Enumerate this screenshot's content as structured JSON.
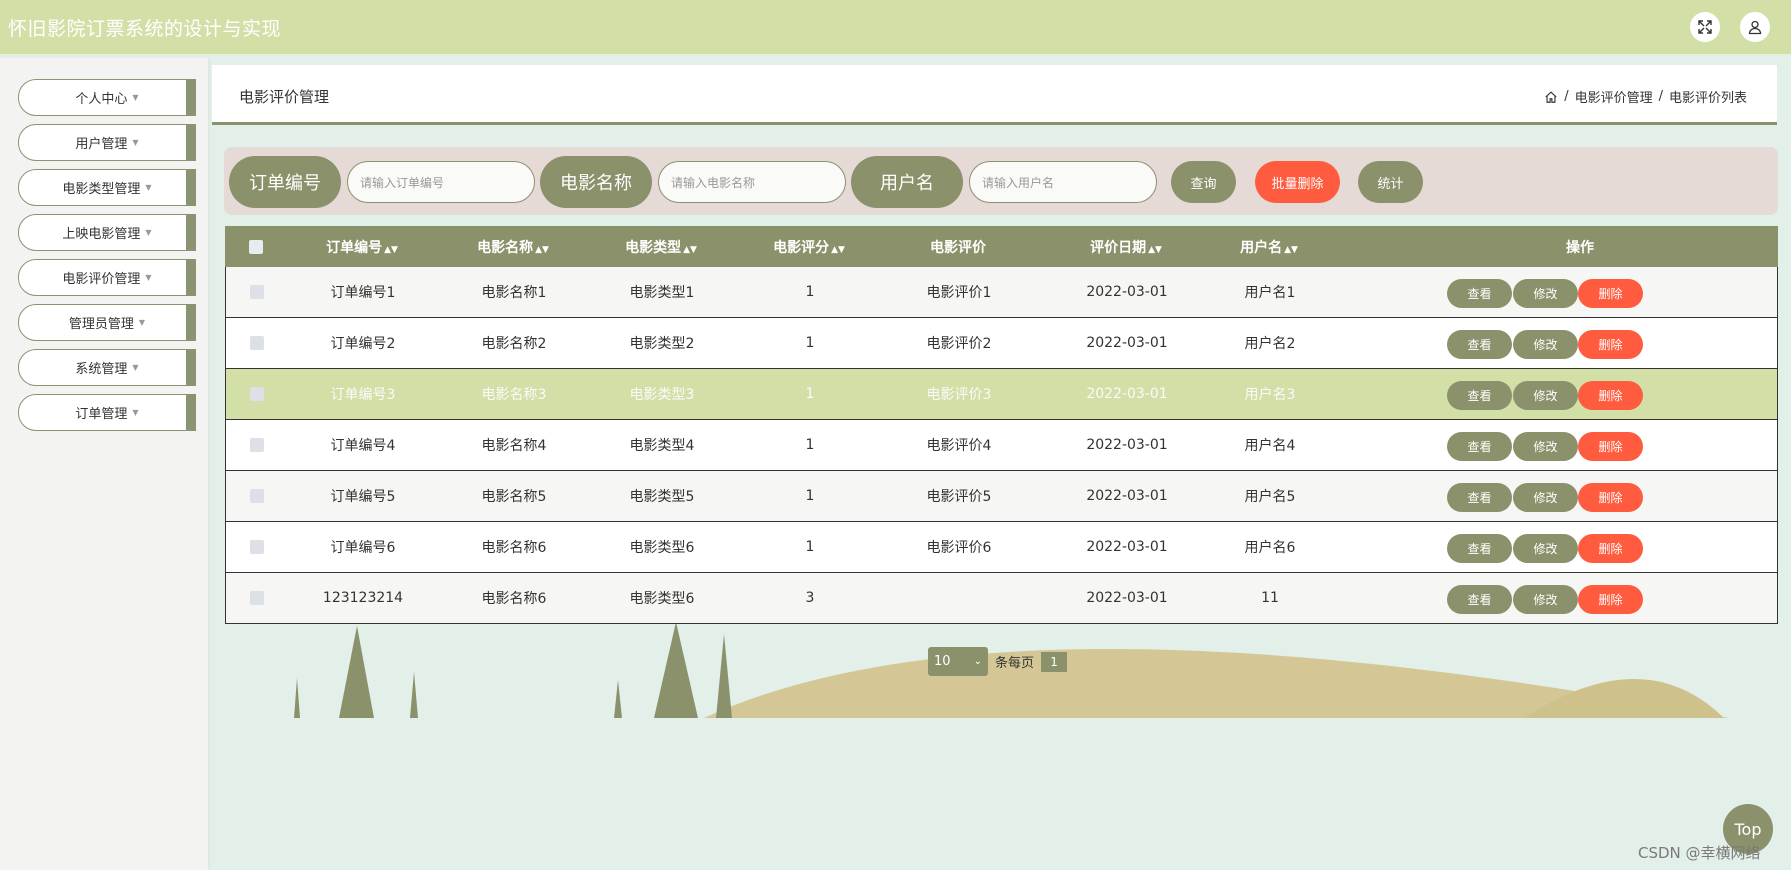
{
  "app": {
    "title": "怀旧影院订票系统的设计与实现"
  },
  "topbar": {
    "fullscreen_icon": "expand-icon",
    "user_icon": "user-icon"
  },
  "sidebar": {
    "items": [
      {
        "label": "个人中心"
      },
      {
        "label": "用户管理"
      },
      {
        "label": "电影类型管理"
      },
      {
        "label": "上映电影管理"
      },
      {
        "label": "电影评价管理"
      },
      {
        "label": "管理员管理"
      },
      {
        "label": "系统管理"
      },
      {
        "label": "订单管理"
      }
    ]
  },
  "header": {
    "title": "电影评价管理",
    "breadcrumb": {
      "sep1": "/",
      "item1": "电影评价管理",
      "sep2": "/",
      "item2": "电影评价列表"
    }
  },
  "search": {
    "order_label": "订单编号",
    "order_placeholder": "请输入订单编号",
    "movie_label": "电影名称",
    "movie_placeholder": "请输入电影名称",
    "user_label": "用户名",
    "user_placeholder": "请输入用户名",
    "query_btn": "查询",
    "batch_delete_btn": "批量删除",
    "stats_btn": "统计"
  },
  "table": {
    "columns": [
      "订单编号",
      "电影名称",
      "电影类型",
      "电影评分",
      "电影评价",
      "评价日期",
      "用户名",
      "操作"
    ],
    "rows": [
      {
        "order": "订单编号1",
        "movie": "电影名称1",
        "type": "电影类型1",
        "score": "1",
        "review": "电影评价1",
        "date": "2022-03-01",
        "user": "用户名1"
      },
      {
        "order": "订单编号2",
        "movie": "电影名称2",
        "type": "电影类型2",
        "score": "1",
        "review": "电影评价2",
        "date": "2022-03-01",
        "user": "用户名2"
      },
      {
        "order": "订单编号3",
        "movie": "电影名称3",
        "type": "电影类型3",
        "score": "1",
        "review": "电影评价3",
        "date": "2022-03-01",
        "user": "用户名3"
      },
      {
        "order": "订单编号4",
        "movie": "电影名称4",
        "type": "电影类型4",
        "score": "1",
        "review": "电影评价4",
        "date": "2022-03-01",
        "user": "用户名4"
      },
      {
        "order": "订单编号5",
        "movie": "电影名称5",
        "type": "电影类型5",
        "score": "1",
        "review": "电影评价5",
        "date": "2022-03-01",
        "user": "用户名5"
      },
      {
        "order": "订单编号6",
        "movie": "电影名称6",
        "type": "电影类型6",
        "score": "1",
        "review": "电影评价6",
        "date": "2022-03-01",
        "user": "用户名6"
      },
      {
        "order": "123123214",
        "movie": "电影名称6",
        "type": "电影类型6",
        "score": "3",
        "review": "",
        "date": "2022-03-01",
        "user": "11"
      }
    ],
    "actions": {
      "view": "查看",
      "edit": "修改",
      "delete": "删除"
    }
  },
  "pagination": {
    "page_size": "10",
    "per_page_label": "条每页",
    "current_page": "1"
  },
  "back_to_top": "Top",
  "watermark": "CSDN @幸横网络",
  "colors": {
    "accent": "#8b916a",
    "topbar": "#d2e0a7",
    "danger": "#ff5b3e",
    "highlight_row": "#d2e0a7"
  }
}
